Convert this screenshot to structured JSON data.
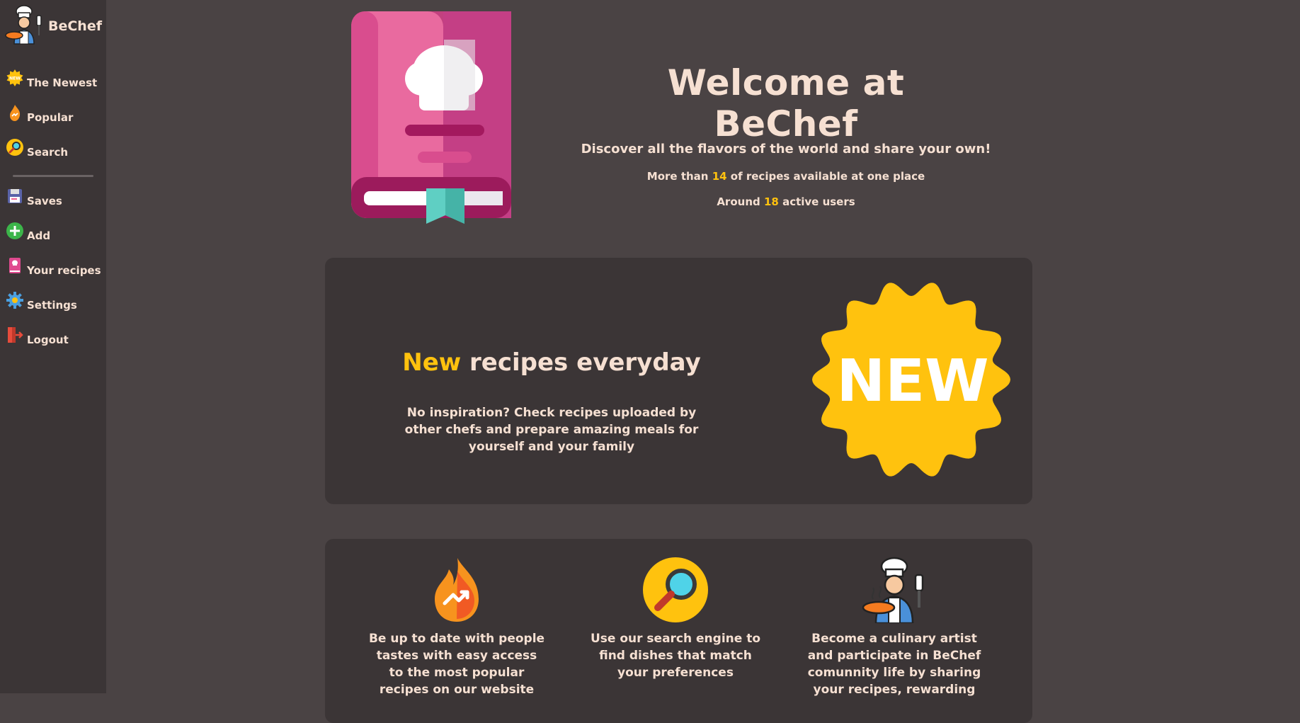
{
  "brand": {
    "name": "BeChef"
  },
  "nav": {
    "items": [
      {
        "label": "The Newest",
        "icon": "new-badge-icon"
      },
      {
        "label": "Popular",
        "icon": "fire-icon"
      },
      {
        "label": "Search",
        "icon": "magnifier-icon"
      },
      {
        "label": "Saves",
        "icon": "floppy-icon"
      },
      {
        "label": "Add",
        "icon": "plus-icon"
      },
      {
        "label": "Your recipes",
        "icon": "recipe-book-icon"
      },
      {
        "label": "Settings",
        "icon": "gear-icon"
      },
      {
        "label": "Logout",
        "icon": "logout-door-icon"
      }
    ]
  },
  "hero": {
    "title": "Welcome at BeChef",
    "subtitle": "Discover all the flavors of the world and share your own!",
    "recipes_prefix": "More than ",
    "recipes_count": "14",
    "recipes_suffix": " of recipes available at one place",
    "users_prefix": "Around ",
    "users_count": "18",
    "users_suffix": " active users"
  },
  "new_section": {
    "title_highlight": "New",
    "title_rest": " recipes everyday",
    "text": "No inspiration? Check recipes uploaded by other chefs and prepare amazing meals for yourself and your family",
    "badge": "NEW"
  },
  "features": [
    {
      "icon": "fire-trend-icon",
      "text": "Be up to date with people tastes with easy access to the most popular recipes on our website"
    },
    {
      "icon": "magnifier-icon",
      "text": "Use our search engine to find dishes that match your preferences"
    },
    {
      "icon": "chef-cooking-icon",
      "text": "Become a culinary artist and participate in BeChef comunnity life by sharing your recipes, rewarding"
    }
  ],
  "colors": {
    "accent": "#ffc20e",
    "background": "#4a4344",
    "panel": "#3b3536",
    "text": "#f6e0d2"
  }
}
